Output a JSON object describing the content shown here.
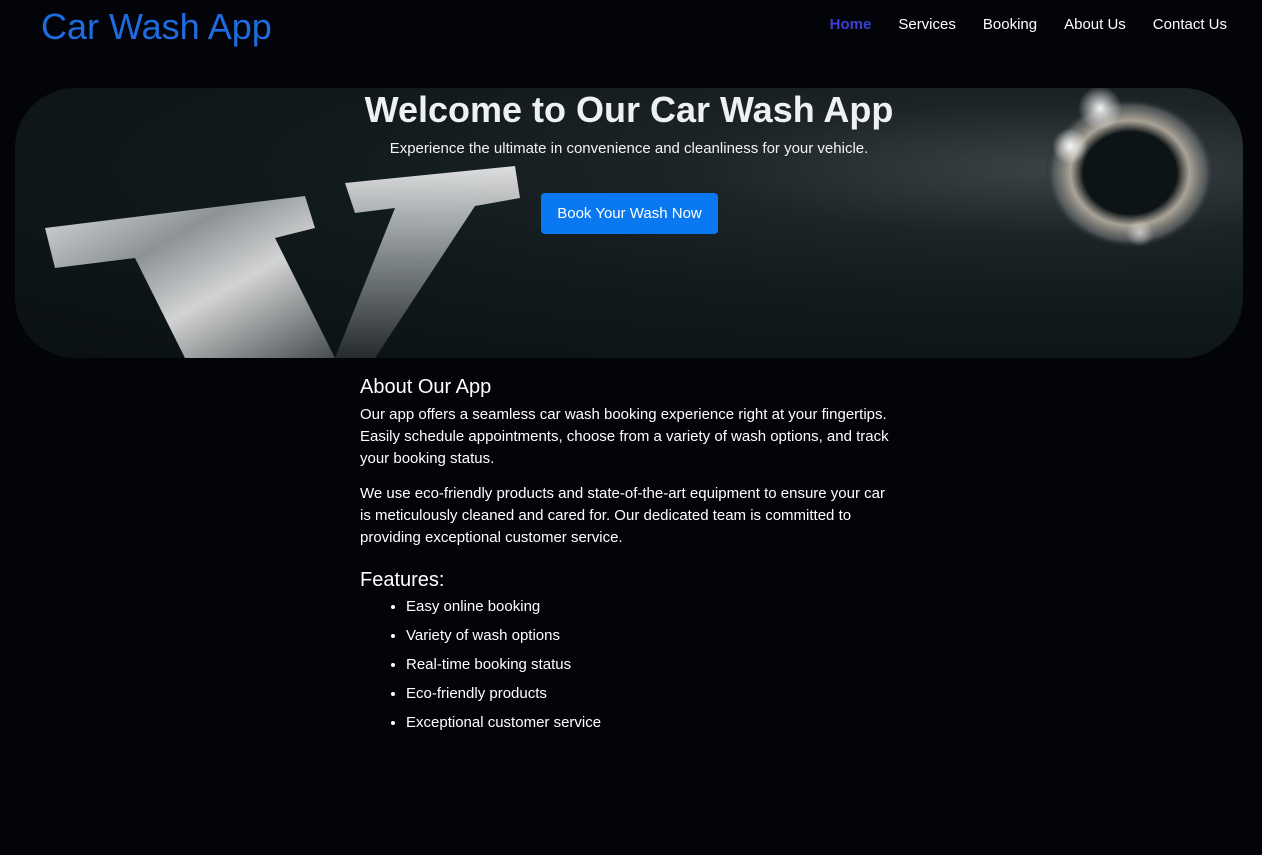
{
  "header": {
    "logo": "Car Wash App",
    "nav": [
      {
        "label": "Home",
        "active": true
      },
      {
        "label": "Services",
        "active": false
      },
      {
        "label": "Booking",
        "active": false
      },
      {
        "label": "About Us",
        "active": false
      },
      {
        "label": "Contact Us",
        "active": false
      }
    ]
  },
  "hero": {
    "title": "Welcome to Our Car Wash App",
    "subtitle": "Experience the ultimate in convenience and cleanliness for your vehicle.",
    "cta_label": "Book Your Wash Now"
  },
  "about": {
    "title": "About Our App",
    "paragraphs": [
      "Our app offers a seamless car wash booking experience right at your fingertips. Easily schedule appointments, choose from a variety of wash options, and track your booking status.",
      "We use eco-friendly products and state-of-the-art equipment to ensure your car is meticulously cleaned and cared for. Our dedicated team is committed to providing exceptional customer service."
    ]
  },
  "features": {
    "title": "Features:",
    "items": [
      "Easy online booking",
      "Variety of wash options",
      "Real-time booking status",
      "Eco-friendly products",
      "Exceptional customer service"
    ]
  },
  "colors": {
    "background": "#03030a",
    "logo": "#1e6ce0",
    "nav_active": "#3b3fd4",
    "button": "#0a78f0"
  }
}
